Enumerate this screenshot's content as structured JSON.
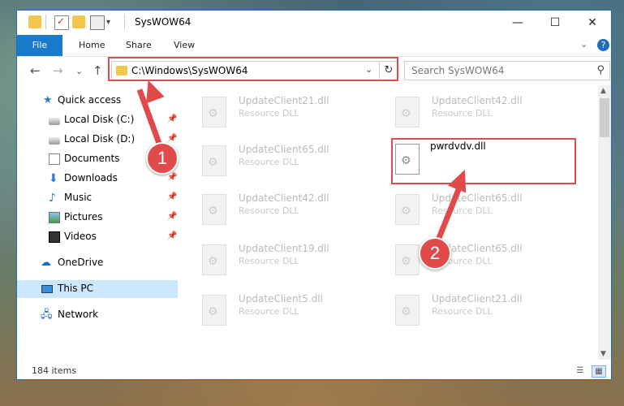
{
  "window": {
    "title": "SysWOW64",
    "controls": {
      "minimize": "—",
      "maximize": "☐",
      "close": "✕"
    }
  },
  "ribbon": {
    "file": "File",
    "tabs": [
      "Home",
      "Share",
      "View"
    ],
    "expand": "⌄",
    "help": "?"
  },
  "navigation": {
    "back": "←",
    "forward": "→",
    "recent": "⌄",
    "up": "↑",
    "address": "C:\\Windows\\SysWOW64",
    "address_dropdown": "⌄",
    "refresh": "↻",
    "search_placeholder": "Search SysWOW64",
    "search_icon": "⚲"
  },
  "sidebar": {
    "items": [
      {
        "label": "Quick access",
        "icon": "star-icon",
        "pinned": false
      },
      {
        "label": "Local Disk (C:)",
        "icon": "drive-icon",
        "pinned": true
      },
      {
        "label": "Local Disk (D:)",
        "icon": "drive-icon",
        "pinned": true
      },
      {
        "label": "Documents",
        "icon": "documents-icon",
        "pinned": true
      },
      {
        "label": "Downloads",
        "icon": "downloads-icon",
        "pinned": true
      },
      {
        "label": "Music",
        "icon": "music-icon",
        "pinned": true
      },
      {
        "label": "Pictures",
        "icon": "pictures-icon",
        "pinned": true
      },
      {
        "label": "Videos",
        "icon": "videos-icon",
        "pinned": true
      },
      {
        "label": "OneDrive",
        "icon": "onedrive-icon",
        "pinned": false
      },
      {
        "label": "This PC",
        "icon": "pc-icon",
        "pinned": false,
        "selected": true
      },
      {
        "label": "Network",
        "icon": "network-icon",
        "pinned": false
      }
    ]
  },
  "files": [
    {
      "name": "UpdateClient21.dll",
      "type": "Resource DLL"
    },
    {
      "name": "UpdateClient42.dll",
      "type": "Resource DLL"
    },
    {
      "name": "UpdateClient65.dll",
      "type": "Resource DLL"
    },
    {
      "name": "pwrdvdv.dll",
      "type": "",
      "highlighted": true
    },
    {
      "name": "UpdateClient42.dll",
      "type": "Resource DLL"
    },
    {
      "name": "UpdateClient65.dll",
      "type": "Resource DLL"
    },
    {
      "name": "UpdateClient19.dll",
      "type": "Resource DLL"
    },
    {
      "name": "UpdateClient65.dll",
      "type": "Resource DLL"
    },
    {
      "name": "UpdateClient5.dll",
      "type": "Resource DLL"
    },
    {
      "name": "UpdateClient21.dll",
      "type": "Resource DLL"
    }
  ],
  "status": {
    "item_count": "184 items"
  },
  "annotations": {
    "step1": "1",
    "step2": "2"
  },
  "colors": {
    "accent": "#1979ca",
    "annotation": "#e04a4a",
    "selection": "#cce8ff"
  }
}
